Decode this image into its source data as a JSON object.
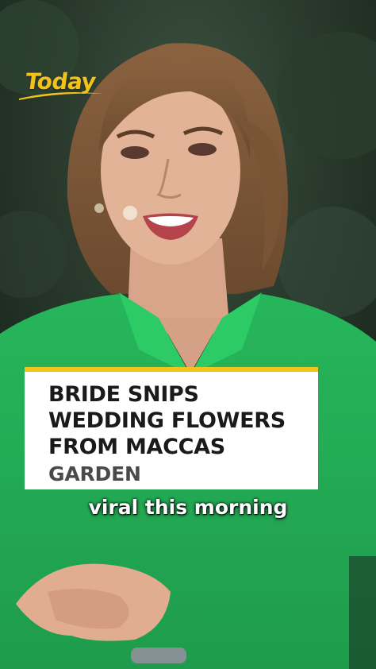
{
  "logo": {
    "text": "Today",
    "color": "#f3c21a"
  },
  "headline": {
    "lines": [
      "BRIDE SNIPS",
      "WEDDING FLOWERS",
      "FROM MACCAS"
    ],
    "sub": "GARDEN",
    "accent_color": "#f5c418"
  },
  "caption": {
    "text": "viral this morning"
  }
}
